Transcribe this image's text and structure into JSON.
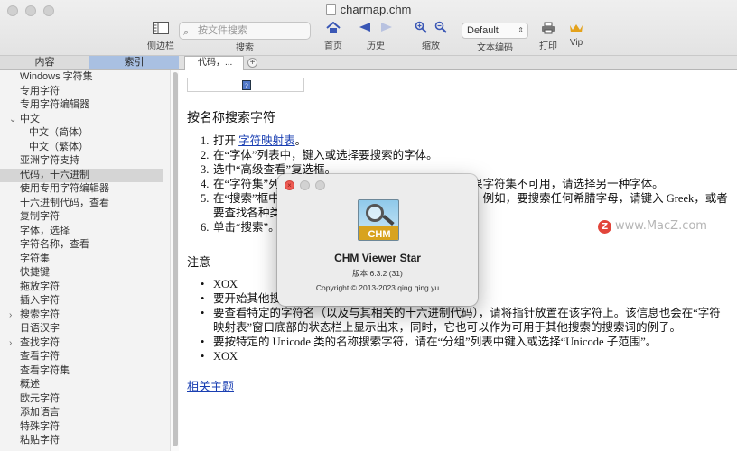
{
  "window": {
    "title": "charmap.chm"
  },
  "toolbar": {
    "sidebar_label": "侧边栏",
    "search_placeholder": "按文件搜索",
    "search_label": "搜索",
    "home_label": "首页",
    "history_label": "历史",
    "zoom_label": "缩放",
    "encoding_value": "Default",
    "encoding_label": "文本编码",
    "print_label": "打印",
    "vip_label": "Vip"
  },
  "sidebar": {
    "tab_contents": "内容",
    "tab_index": "索引",
    "items": [
      {
        "label": "Windows 字符集",
        "level": 0,
        "chevron": ""
      },
      {
        "label": "专用字符",
        "level": 0,
        "chevron": ""
      },
      {
        "label": "专用字符编辑器",
        "level": 0,
        "chevron": ""
      },
      {
        "label": "中文",
        "level": 0,
        "chevron": "⌄"
      },
      {
        "label": "中文（简体）",
        "level": 1,
        "chevron": ""
      },
      {
        "label": "中文（繁体）",
        "level": 1,
        "chevron": ""
      },
      {
        "label": "亚洲字符支持",
        "level": 0,
        "chevron": ""
      },
      {
        "label": "代码，十六进制",
        "level": 0,
        "chevron": "",
        "selected": true
      },
      {
        "label": "使用专用字符编辑器",
        "level": 0,
        "chevron": ""
      },
      {
        "label": "十六进制代码，查看",
        "level": 0,
        "chevron": ""
      },
      {
        "label": "复制字符",
        "level": 0,
        "chevron": ""
      },
      {
        "label": "字体，选择",
        "level": 0,
        "chevron": ""
      },
      {
        "label": "字符名称，查看",
        "level": 0,
        "chevron": ""
      },
      {
        "label": "字符集",
        "level": 0,
        "chevron": ""
      },
      {
        "label": "快捷键",
        "level": 0,
        "chevron": ""
      },
      {
        "label": "拖放字符",
        "level": 0,
        "chevron": ""
      },
      {
        "label": "插入字符",
        "level": 0,
        "chevron": ""
      },
      {
        "label": "搜索字符",
        "level": 0,
        "chevron": "›"
      },
      {
        "label": "日语汉字",
        "level": 0,
        "chevron": ""
      },
      {
        "label": "查找字符",
        "level": 0,
        "chevron": "›"
      },
      {
        "label": "查看字符",
        "level": 0,
        "chevron": ""
      },
      {
        "label": "查看字符集",
        "level": 0,
        "chevron": ""
      },
      {
        "label": "概述",
        "level": 0,
        "chevron": ""
      },
      {
        "label": "欧元字符",
        "level": 0,
        "chevron": ""
      },
      {
        "label": "添加语言",
        "level": 0,
        "chevron": ""
      },
      {
        "label": "特殊字符",
        "level": 0,
        "chevron": ""
      },
      {
        "label": "粘贴字符",
        "level": 0,
        "chevron": ""
      }
    ]
  },
  "content_tab": {
    "label": "代码，...",
    "add": "+"
  },
  "content": {
    "help_glyph": "?",
    "heading": "按名称搜索字符",
    "steps": [
      {
        "num": "1.",
        "pre": "打开 ",
        "link": "字符映射表",
        "post": "。"
      },
      {
        "num": "2.",
        "pre": "在“字体”列表中，键入或选择要搜索的字体。",
        "link": "",
        "post": ""
      },
      {
        "num": "3.",
        "pre": "选中“高级查看”复选框。",
        "link": "",
        "post": ""
      },
      {
        "num": "4.",
        "pre": "在“字符集”列表中，键入或选择要使用的字符集。如果字符集不可用，请选择另一种字体。",
        "link": "",
        "post": ""
      },
      {
        "num": "5.",
        "pre": "在“搜索”框中，键入要查找的字符的全名或部分名称。例如，要搜索任何希腊字母，请键入 Greek，或者要查找各种类型的箭头，请键入 Arrow。",
        "link": "",
        "post": ""
      },
      {
        "num": "6.",
        "pre": "单击“搜索”。",
        "link": "",
        "post": ""
      }
    ],
    "note_heading": "注意",
    "notes": [
      "XOX",
      "要开始其他搜索，请单击“重置”。",
      "要查看特定的字符名（以及与其相关的十六进制代码），请将指针放置在该字符上。该信息也会在“字符映射表”窗口底部的状态栏上显示出来，同时，它也可以作为可用于其他搜索的搜索词的例子。",
      "要按特定的 Unicode 类的名称搜索字符，请在“分组”列表中键入或选择“Unicode 子范围”。",
      "XOX"
    ],
    "related": "相关主题"
  },
  "about": {
    "logo_text": "CHM",
    "name": "CHM Viewer Star",
    "version": "版本 6.3.2 (31)",
    "copyright": "Copyright © 2013-2023 qing qing yu"
  },
  "watermark": {
    "text": "www.MacZ.com",
    "badge": "Z"
  }
}
